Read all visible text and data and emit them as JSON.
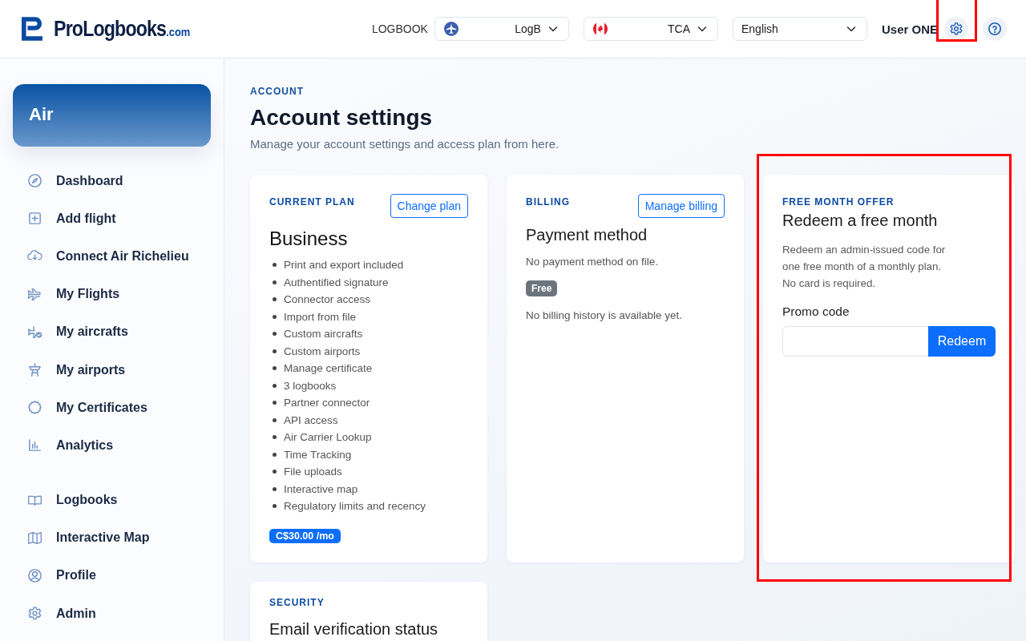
{
  "header": {
    "logo": {
      "name": "ProLogbooks",
      "suffix": ".com"
    },
    "logbook_label": "LOGBOOK",
    "selects": [
      {
        "kind": "plane",
        "value": "LogB"
      },
      {
        "kind": "flag",
        "value": "TCA"
      },
      {
        "kind": "plain",
        "value": "English"
      }
    ],
    "user": "User ONE",
    "buttons": [
      {
        "kind": "settings",
        "highlighted": true
      },
      {
        "kind": "help",
        "highlighted": false
      }
    ]
  },
  "sidebar": {
    "section": "Air",
    "groups": [
      [
        {
          "kind": "compass",
          "label": "Dashboard"
        },
        {
          "kind": "plus",
          "label": "Add flight"
        },
        {
          "kind": "cloud",
          "label": "Connect Air Richelieu"
        },
        {
          "kind": "plane",
          "label": "My Flights"
        },
        {
          "kind": "plane-check",
          "label": "My aircrafts"
        },
        {
          "kind": "tower",
          "label": "My airports"
        },
        {
          "kind": "seal",
          "label": "My Certificates"
        },
        {
          "kind": "chart",
          "label": "Analytics"
        }
      ],
      [
        {
          "kind": "book",
          "label": "Logbooks"
        },
        {
          "kind": "map",
          "label": "Interactive Map"
        },
        {
          "kind": "user",
          "label": "Profile"
        },
        {
          "kind": "gear",
          "label": "Admin"
        }
      ]
    ]
  },
  "page": {
    "eyebrow": "ACCOUNT",
    "title": "Account settings",
    "subtitle": "Manage your account settings and access plan from here."
  },
  "cards": [
    {
      "kind": "plan",
      "eyebrow": "CURRENT PLAN",
      "action": "Change plan",
      "title": "Business",
      "features": [
        "Print and export included",
        "Authentified signature",
        "Connector access",
        "Import from file",
        "Custom aircrafts",
        "Custom airports",
        "Manage certificate",
        "3 logbooks",
        "Partner connector",
        "API access",
        "Air Carrier Lookup",
        "Time Tracking",
        "File uploads",
        "Interactive map",
        "Regulatory limits and recency"
      ],
      "price": "C$30.00 /mo",
      "highlighted": false
    },
    {
      "kind": "billing",
      "eyebrow": "BILLING",
      "action": "Manage billing",
      "title": "Payment method",
      "note": "No payment method on file.",
      "badge": "Free",
      "history": "No billing history is available yet.",
      "highlighted": false
    },
    {
      "kind": "offer",
      "eyebrow": "FREE MONTH OFFER",
      "title": "Redeem a free month",
      "text": "Redeem an admin-issued code for one free month of a monthly plan. No card is required.",
      "field_label": "Promo code",
      "button": "Redeem",
      "highlighted": true
    },
    {
      "kind": "security",
      "eyebrow": "SECURITY",
      "title": "Email verification status",
      "highlighted": false
    }
  ]
}
